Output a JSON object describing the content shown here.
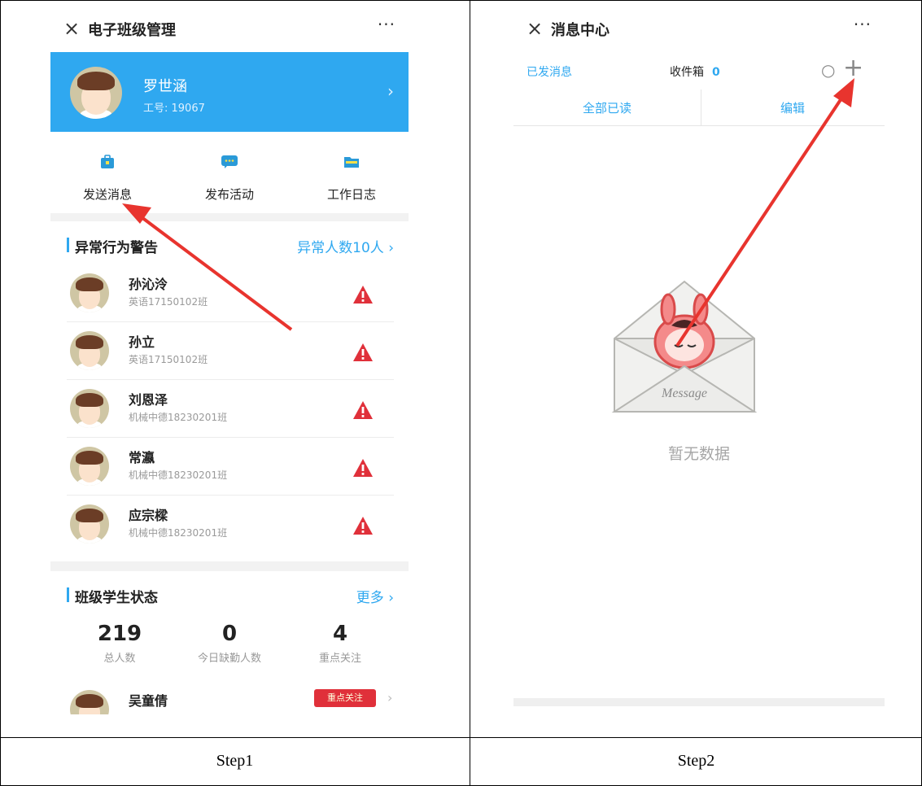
{
  "step1": {
    "header": {
      "close_icon": "×",
      "title": "电子班级管理",
      "more_icon": "···"
    },
    "profile": {
      "name": "罗世涵",
      "job_number": "工号: 19067",
      "arrow": "›"
    },
    "actions": [
      {
        "label": "发送消息",
        "icon": "briefcase-icon",
        "color": "#2a9ad8"
      },
      {
        "label": "发布活动",
        "icon": "chat-icon",
        "color": "#2a9ad8"
      },
      {
        "label": "工作日志",
        "icon": "folder-icon",
        "color": "#2a9ad8"
      }
    ],
    "warnings": {
      "title": "异常行为警告",
      "link": "异常人数10人 ›",
      "rows": [
        {
          "name": "孙沁泠",
          "class": "英语17150102班"
        },
        {
          "name": "孙立",
          "class": "英语17150102班"
        },
        {
          "name": "刘恩泽",
          "class": "机械中德18230201班"
        },
        {
          "name": "常瀛",
          "class": "机械中德18230201班"
        },
        {
          "name": "应宗樑",
          "class": "机械中德18230201班"
        }
      ]
    },
    "status": {
      "title": "班级学生状态",
      "link": "更多 ›",
      "stats": [
        {
          "value": "219",
          "label": "总人数"
        },
        {
          "value": "0",
          "label": "今日缺勤人数"
        },
        {
          "value": "4",
          "label": "重点关注"
        }
      ],
      "partial_row": {
        "name": "吴童倩",
        "tag": "重点关注"
      }
    },
    "caption": "Step1"
  },
  "step2": {
    "header": {
      "close_icon": "×",
      "title": "消息中心",
      "more_icon": "···"
    },
    "tabs": {
      "sent": "已发消息",
      "inbox": "收件箱",
      "inbox_count": "0",
      "search_icon": "○",
      "add_icon": "+"
    },
    "ops": {
      "mark_all_read": "全部已读",
      "edit": "编辑"
    },
    "illustration_text": "Message",
    "empty_text": "暂无数据",
    "caption": "Step2"
  },
  "colors": {
    "accent": "#2fa8f0",
    "warn": "#e0303a",
    "arrow": "#e8342e"
  }
}
